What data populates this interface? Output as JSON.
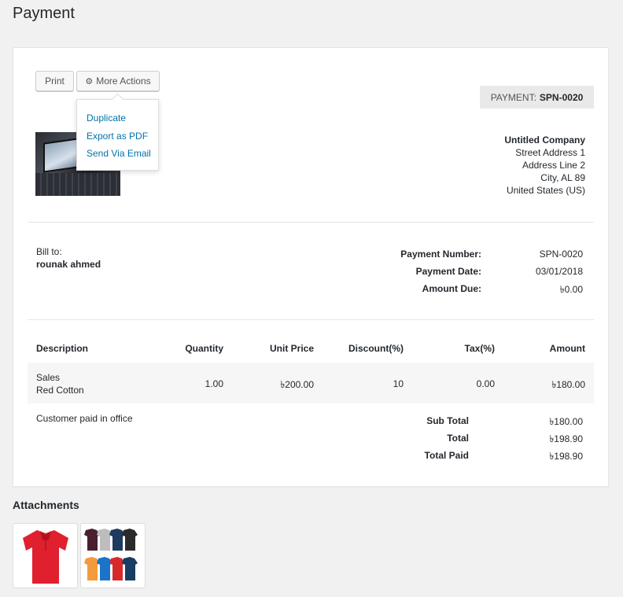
{
  "page": {
    "title": "Payment"
  },
  "toolbar": {
    "print_label": "Print",
    "more_actions_label": "More Actions",
    "menu": [
      "Duplicate",
      "Export as PDF",
      "Send Via Email"
    ]
  },
  "badge": {
    "prefix": "PAYMENT:",
    "number": "SPN-0020"
  },
  "company": {
    "name": "Untitled Company",
    "lines": [
      "Street Address 1",
      "Address Line 2",
      "City, AL 89",
      "United States (US)"
    ]
  },
  "bill_to": {
    "label": "Bill to:",
    "name": "rounak ahmed"
  },
  "meta": [
    {
      "label": "Payment Number:",
      "value": "SPN-0020"
    },
    {
      "label": "Payment Date:",
      "value": "03/01/2018"
    },
    {
      "label": "Amount Due:",
      "value": "৳0.00"
    }
  ],
  "table": {
    "headers": [
      "Description",
      "Quantity",
      "Unit Price",
      "Discount(%)",
      "Tax(%)",
      "Amount"
    ],
    "rows": [
      {
        "title": "Sales",
        "subtitle": "Red Cotton",
        "quantity": "1.00",
        "unit_price": "৳200.00",
        "discount": "10",
        "tax": "0.00",
        "amount": "৳180.00"
      }
    ]
  },
  "notes": "Customer paid in office",
  "totals": [
    {
      "label": "Sub Total",
      "value": "৳180.00"
    },
    {
      "label": "Total",
      "value": "৳198.90"
    },
    {
      "label": "Total Paid",
      "value": "৳198.90"
    }
  ],
  "attachments": {
    "title": "Attachments"
  },
  "colors": {
    "link": "#0073aa",
    "background": "#f1f1f1",
    "shirt_red": "#e0202e"
  },
  "icons": {
    "more_actions": "gear-icon"
  }
}
